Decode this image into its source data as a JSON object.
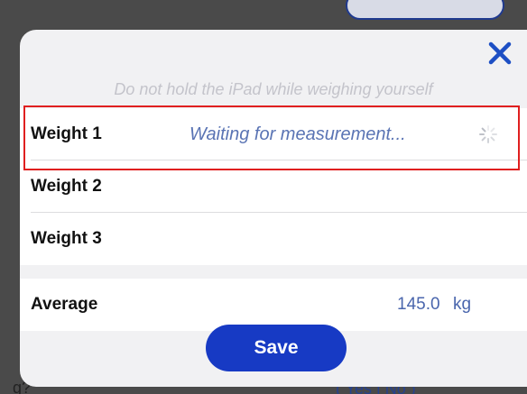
{
  "modal": {
    "hint": "Do not hold the iPad while weighing yourself",
    "close_icon": "close-icon"
  },
  "weights": [
    {
      "label": "Weight 1",
      "status": "Waiting for measurement...",
      "loading": true
    },
    {
      "label": "Weight 2",
      "status": ""
    },
    {
      "label": "Weight 3",
      "status": ""
    }
  ],
  "average": {
    "label": "Average",
    "value": "145.0",
    "unit": "kg"
  },
  "actions": {
    "save_label": "Save"
  },
  "background": {
    "bottom_text": "( Yes | No )",
    "left_fragment": "g?"
  },
  "colors": {
    "accent": "#173ac4",
    "status_text": "#5a74b4",
    "highlight": "#e01f1f",
    "close_icon": "#1d4fc4"
  }
}
